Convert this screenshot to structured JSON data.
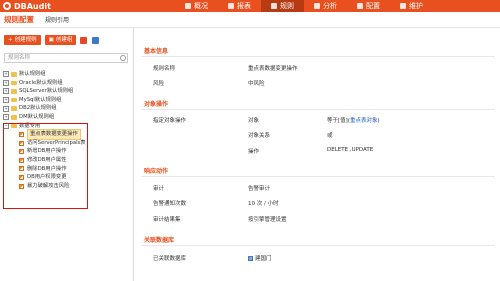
{
  "app": {
    "title": "DBAudit"
  },
  "nav": {
    "items": [
      {
        "label": "概况",
        "active": false
      },
      {
        "label": "报表",
        "active": false
      },
      {
        "label": "规则",
        "active": true
      },
      {
        "label": "分析",
        "active": false
      },
      {
        "label": "配置",
        "active": false
      },
      {
        "label": "维护",
        "active": false
      }
    ]
  },
  "page": {
    "title": "规则配置",
    "sub_link": "规则引用"
  },
  "toolbar": {
    "new_rule": "创建规则",
    "new_group": "创建组"
  },
  "search": {
    "placeholder": "规则名称"
  },
  "tree": {
    "groups": [
      {
        "label": "默认规则组",
        "expanded": false
      },
      {
        "label": "Oracle默认规则组",
        "expanded": false
      },
      {
        "label": "SQLServer默认规则组",
        "expanded": false
      },
      {
        "label": "MySql默认规则组",
        "expanded": false
      },
      {
        "label": "DB2默认规则组",
        "expanded": false
      },
      {
        "label": "DM默认规则组",
        "expanded": false
      },
      {
        "label": "数据专用",
        "expanded": true
      }
    ],
    "children": [
      {
        "label": "重点表数据变更操作",
        "selected": true
      },
      {
        "label": "访问ServerPrincipals表",
        "selected": false
      },
      {
        "label": "新增DB用户操作",
        "selected": false
      },
      {
        "label": "修改DB用户属性",
        "selected": false
      },
      {
        "label": "删除DB用户操作",
        "selected": false
      },
      {
        "label": "DB用户权限变更",
        "selected": false
      },
      {
        "label": "暴力破解攻击风险",
        "selected": false
      }
    ]
  },
  "detail": {
    "basic": {
      "section": "基本信息",
      "name_label": "规则名称",
      "name_value": "重点表数据变更操作",
      "risk_label": "风险",
      "risk_value": "中风险"
    },
    "target": {
      "section": "对象操作",
      "label": "指定对象操作",
      "object_label": "对象",
      "object_value": "等于[值]",
      "object_link": "重点表对象",
      "relation_label": "对象关系",
      "relation_value": "或",
      "op_label": "操作",
      "op_value": "DELETE ,UPDATE"
    },
    "response": {
      "section": "响应动作",
      "audit_label": "审计",
      "audit_value": "告警审计",
      "count_label": "告警通知次数",
      "count_value": "10 次 / 小时",
      "result_label": "审计结果集",
      "result_value": "按引擎管理设置"
    },
    "db": {
      "section": "关联数据库",
      "label": "已关联数据库",
      "value": "建国门"
    }
  },
  "colors": {
    "brand": "#e8501f",
    "highlight_box": "#e01010"
  }
}
